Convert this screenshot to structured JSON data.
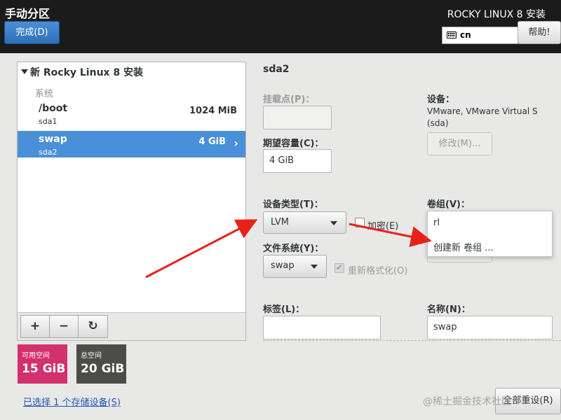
{
  "header": {
    "title": "手动分区",
    "done_label": "完成(D)",
    "os_title": "ROCKY LINUX 8 安装",
    "keyboard_layout": "cn",
    "help_label": "帮助!"
  },
  "tree": {
    "root_label": "新 Rocky Linux 8 安装",
    "group_label": "系统",
    "partitions": [
      {
        "name": "/boot",
        "device": "sda1",
        "size": "1024 MiB",
        "selected": false
      },
      {
        "name": "swap",
        "device": "sda2",
        "size": "4 GiB",
        "selected": true
      }
    ],
    "toolbar": {
      "add": "+",
      "remove": "−",
      "refresh": "↻"
    }
  },
  "storage": {
    "available_label": "可用空间",
    "available_value": "15 GiB",
    "total_label": "总空间",
    "total_value": "20 GiB",
    "selected_devices_link": "已选择 1 个存储设备(S)",
    "colors": {
      "available": "#d3306e",
      "total": "#4c4c4a"
    }
  },
  "details": {
    "title": "sda2",
    "mount_point_label": "挂载点(P)：",
    "mount_point_value": "",
    "desired_capacity_label": "期望容量(C)：",
    "desired_capacity_value": "4 GiB",
    "device_label": "设备：",
    "device_value": "VMware, VMware Virtual S (sda)",
    "modify_label": "修改(M)...",
    "device_type_label": "设备类型(T)：",
    "device_type_value": "LVM",
    "encrypt_label": "加密(E)",
    "encrypt_checked": false,
    "volume_group_label": "卷组(V)：",
    "volume_group_options": [
      "rl",
      "创建新 卷组 ..."
    ],
    "filesystem_label": "文件系统(Y)：",
    "filesystem_value": "swap",
    "reformat_label": "重新格式化(O)",
    "reformat_checked": true,
    "tag_label": "标签(L)：",
    "tag_value": "",
    "name_label": "名称(N)：",
    "name_value": "swap",
    "reset_all_label": "全部重设(R)"
  },
  "watermark": "@稀土掘金技术社区"
}
